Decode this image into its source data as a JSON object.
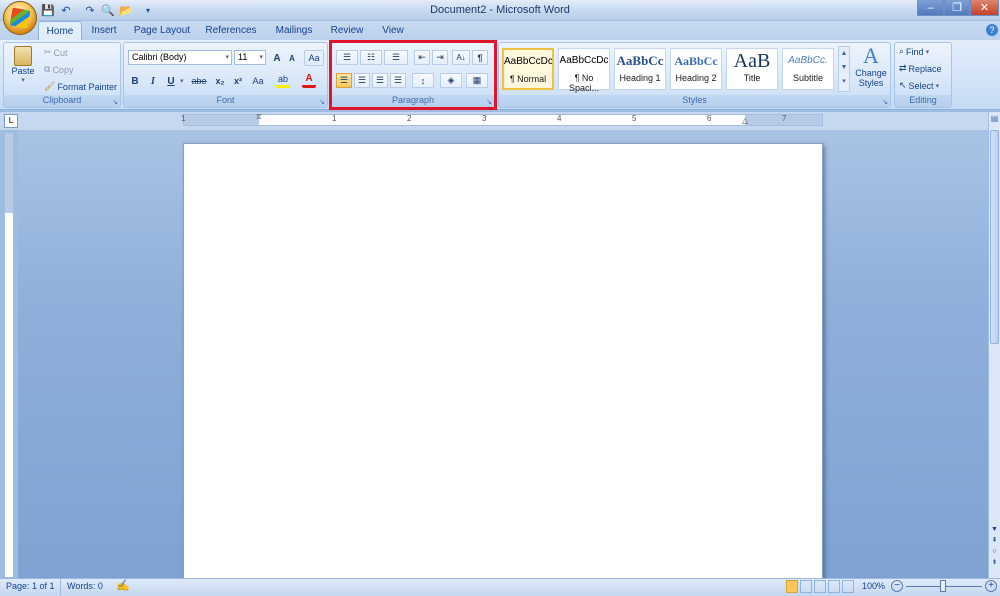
{
  "window": {
    "title": "Document2 - Microsoft Word",
    "buttons": {
      "minimize": "–",
      "restore": "❐",
      "close": "✕"
    }
  },
  "quick_access": {
    "save": "💾",
    "undo": "↶",
    "redo": "↷",
    "preview": "🔍",
    "open": "📂",
    "customize": "▾"
  },
  "tabs": [
    "Home",
    "Insert",
    "Page Layout",
    "References",
    "Mailings",
    "Review",
    "View"
  ],
  "active_tab": "Home",
  "help": "?",
  "clipboard": {
    "label": "Clipboard",
    "paste": "Paste",
    "cut": "Cut",
    "copy": "Copy",
    "format_painter": "Format Painter"
  },
  "font": {
    "label": "Font",
    "family": "Calibri (Body)",
    "size": "11",
    "grow": "A",
    "shrink": "A",
    "clear": "Aa",
    "bold": "B",
    "italic": "I",
    "underline": "U",
    "strike": "abe",
    "subscript": "x₂",
    "superscript": "x²",
    "change_case": "Aa",
    "highlight": "ab",
    "font_color": "A"
  },
  "paragraph": {
    "label": "Paragraph",
    "bullets": "☰",
    "numbering": "☷",
    "multilevel": "☰",
    "decrease_indent": "⇤",
    "increase_indent": "⇥",
    "sort": "A↓",
    "show_marks": "¶",
    "align_left": "☰",
    "center": "☰",
    "align_right": "☰",
    "justify": "☰",
    "line_spacing": "↕",
    "shading": "◈",
    "borders": "▦"
  },
  "styles": {
    "label": "Styles",
    "items": [
      {
        "sample": "AaBbCcDc",
        "name": "¶ Normal"
      },
      {
        "sample": "AaBbCcDc",
        "name": "¶ No Spaci..."
      },
      {
        "sample": "AaBbCc",
        "name": "Heading 1"
      },
      {
        "sample": "AaBbCc",
        "name": "Heading 2"
      },
      {
        "sample": "AaB",
        "name": "Title"
      },
      {
        "sample": "AaBbCc.",
        "name": "Subtitle"
      }
    ],
    "change_styles": "Change Styles"
  },
  "editing": {
    "label": "Editing",
    "find": "Find",
    "replace": "Replace",
    "select": "Select"
  },
  "ruler": {
    "numbers": [
      "1",
      "1",
      "2",
      "3",
      "4",
      "5",
      "6",
      "7"
    ]
  },
  "status": {
    "page": "Page: 1 of 1",
    "words": "Words: 0",
    "zoom": "100%"
  },
  "colors": {
    "highlight": "#e0142c",
    "accent": "#15428b"
  }
}
